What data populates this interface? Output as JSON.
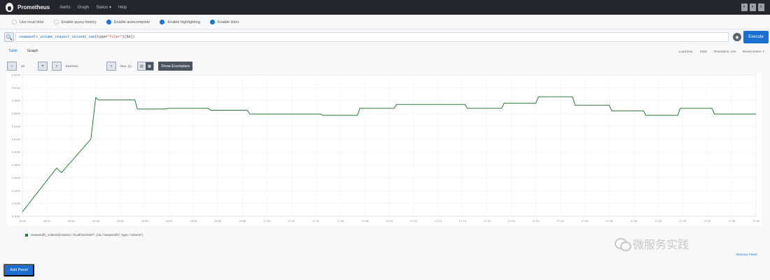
{
  "nav": {
    "brand": "Prometheus",
    "items": [
      "Alerts",
      "Graph",
      "Status ▾",
      "Help"
    ],
    "right_buttons": [
      "◐",
      "◐",
      "◐"
    ]
  },
  "options": [
    {
      "label": "Use local time",
      "checked": false
    },
    {
      "label": "Enable query history",
      "checked": false
    },
    {
      "label": "Enable autocomplete",
      "checked": true
    },
    {
      "label": "Enable highlighting",
      "checked": true
    },
    {
      "label": "Enable linter",
      "checked": true
    }
  ],
  "query": {
    "metric": "seaweedfs_volume_request_seconds_sum",
    "labels": "{type=",
    "string": "\"filer\"",
    "suffix": "}[5m])"
  },
  "tabs": {
    "table": "Table",
    "graph": "Graph"
  },
  "tabs_right": [
    "Load time",
    "Stats",
    "Resolution: 14s",
    "Result series: 1"
  ],
  "controls": {
    "range_value": "1h",
    "end_time_placeholder": "End time",
    "res_value": "Res. (s)",
    "show_exemplars": "Show Exemplars"
  },
  "legend": "seaweedfs_volume{instance=\"localhost:9327\", job=\"seaweedfs\", type=\"volume\"}",
  "watermark": "微服务实践",
  "remove_panel": "Remove Panel",
  "add_panel": "Add Panel",
  "colors": {
    "series": "#2d7a3e",
    "accent": "#1a77d7"
  },
  "chart_data": {
    "type": "line",
    "x_ticks": [
      "16:40",
      "16:42",
      "16:44",
      "16:46",
      "16:48",
      "16:50",
      "16:52",
      "16:54",
      "16:56",
      "16:58",
      "17:00",
      "17:02",
      "17:04",
      "17:06",
      "17:08",
      "17:10",
      "17:12",
      "17:14",
      "17:16",
      "17:18",
      "17:20",
      "17:22",
      "17:24",
      "17:26",
      "17:28",
      "17:30",
      "17:32",
      "17:34",
      "17:36",
      "17:38",
      "17:40"
    ],
    "y_ticks": [
      "0.3000",
      "0.3200",
      "0.3400",
      "0.3600",
      "0.3800",
      "0.4000",
      "0.4200",
      "0.4400",
      "0.4600",
      "0.4800",
      "0.5000",
      "0.5200"
    ],
    "ylim": [
      0.3,
      0.52
    ],
    "xlim": [
      0,
      30
    ],
    "series": [
      {
        "points": [
          [
            0,
            0.307
          ],
          [
            1.4,
            0.375
          ],
          [
            1.6,
            0.368
          ],
          [
            2.8,
            0.42
          ],
          [
            3.0,
            0.485
          ],
          [
            3.1,
            0.481
          ],
          [
            4.6,
            0.481
          ],
          [
            4.7,
            0.467
          ],
          [
            5.8,
            0.467
          ],
          [
            6.0,
            0.468
          ],
          [
            7.6,
            0.468
          ],
          [
            7.7,
            0.465
          ],
          [
            9.2,
            0.465
          ],
          [
            9.3,
            0.459
          ],
          [
            12.2,
            0.459
          ],
          [
            12.3,
            0.457
          ],
          [
            13.7,
            0.457
          ],
          [
            13.8,
            0.468
          ],
          [
            15.2,
            0.468
          ],
          [
            15.3,
            0.474
          ],
          [
            18.1,
            0.474
          ],
          [
            18.2,
            0.468
          ],
          [
            19.6,
            0.468
          ],
          [
            19.7,
            0.476
          ],
          [
            21.0,
            0.476
          ],
          [
            21.1,
            0.486
          ],
          [
            22.5,
            0.486
          ],
          [
            22.6,
            0.473
          ],
          [
            24.0,
            0.473
          ],
          [
            24.1,
            0.464
          ],
          [
            25.4,
            0.464
          ],
          [
            25.5,
            0.457
          ],
          [
            26.8,
            0.457
          ],
          [
            26.9,
            0.468
          ],
          [
            28.2,
            0.468
          ],
          [
            28.3,
            0.459
          ],
          [
            30,
            0.459
          ]
        ]
      }
    ]
  }
}
